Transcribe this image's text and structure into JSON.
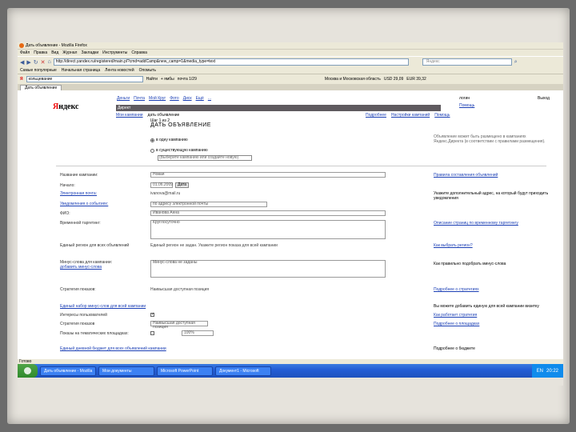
{
  "browser": {
    "title": "Дать объявление - Mozilla Firefox",
    "menu": [
      "Файл",
      "Правка",
      "Вид",
      "Журнал",
      "Закладки",
      "Инструменты",
      "Справка"
    ],
    "url": "http://direct.yandex.ru/registered/main.pl?cmd=addCamp&new_camp=1&media_type=text",
    "search_placeholder": "Яндекс",
    "bookmarks": [
      "Самые популярные",
      "Начальная страница",
      "Лента новостей",
      "Опомыть"
    ],
    "yandex_bar": {
      "logo": "Я",
      "query": "кольцевание",
      "find_label": "Найти",
      "weather": "+ ямбы",
      "mail": "почта 1/29",
      "region": "Москва и Московская область",
      "usd": "USD 29,09",
      "eur": "EUR 39,32"
    },
    "tab_label": "Дать объявление"
  },
  "page": {
    "logo_black": "Я",
    "logo_red": "ндекс",
    "top_links": [
      "Деньги",
      "Почта",
      "Мой Круг",
      "Фото",
      "Диск",
      "Ещё",
      "..."
    ],
    "greybar_title": "Директ",
    "subtabs": [
      "Мои кампании",
      "дать объявление"
    ],
    "right_links": [
      "Подробнее",
      "Настройки кампаний",
      "Помощь"
    ],
    "user_name": "логин",
    "user_link": "Помощь",
    "exit": "Выход",
    "add_header": "Шаг 1 из 2",
    "add_title": "ДАТЬ ОБЪЯВЛЕНИЕ",
    "radio_1": "в одну кампанию",
    "radio_2": "в существующую кампанию",
    "rubric_placeholder": "(Выберите кампанию или создайте новую)",
    "note_right": "Объявление может быть размещено в кампаниях Яндекс.Директа (в соответствии с правилами размещения).",
    "form": {
      "name_label": "Название кампании:",
      "name_value": "Новая",
      "start_label": "Начало:",
      "start_value": "01.06.2009",
      "start_btn": "Дата",
      "email_label": "Электронная почта:",
      "email_value": "ivanova@mail.ru",
      "contact_label": "Уведомления о событиях:",
      "contact_value": "по адресу электронной почты",
      "fio_label": "ФИО:",
      "fio_value": "Иванова Анна",
      "phone_label": "Временной таргетинг:",
      "phone_value": "Круглосуточно",
      "geo_label": "Единый регион для всех объявлений",
      "geo_value": "Единый регион не задан. Укажите регион показа для всей кампании",
      "minus_label": "Минус-слова для кампании:",
      "minus_link": "добавить минус-слова",
      "minus_value": "Минус-слова не заданы",
      "strategy_label": "Стратегия показов:",
      "strategy_value": "Наивысшая доступная позиция",
      "single_link": "Единый набор минус-слов для всей кампании",
      "interests_label": "Интересы пользователей",
      "context_label": "Стратегия показов",
      "context_value": "Наивысшая доступная позиция",
      "percent_label": "Показы на тематических площадках:",
      "percent_field": "100%",
      "final_link": "Единый дневной бюджет для всех объявлений кампании"
    },
    "hints": [
      "Правила составления объявлений",
      "Укажите дополнительный адрес, на который будут приходить уведомления",
      "Описание страниц по временному таргетингу",
      "Как выбрать регион?",
      "Как правильно подобрать минус-слова",
      "Подробнее о стратегиях",
      "Как работает стратегия",
      "Подробнее о площадках",
      "Вы можете добавить единую для всей кампании визитку",
      "Подробнее о бюджете"
    ],
    "bottom_status": "Готово"
  },
  "taskbar": {
    "items": [
      "Дать объявление - Mozilla",
      "Мои документы",
      "Microsoft PowerPoint",
      "Документ1 - Microsoft"
    ],
    "clock": "20:22",
    "lang": "EN"
  }
}
